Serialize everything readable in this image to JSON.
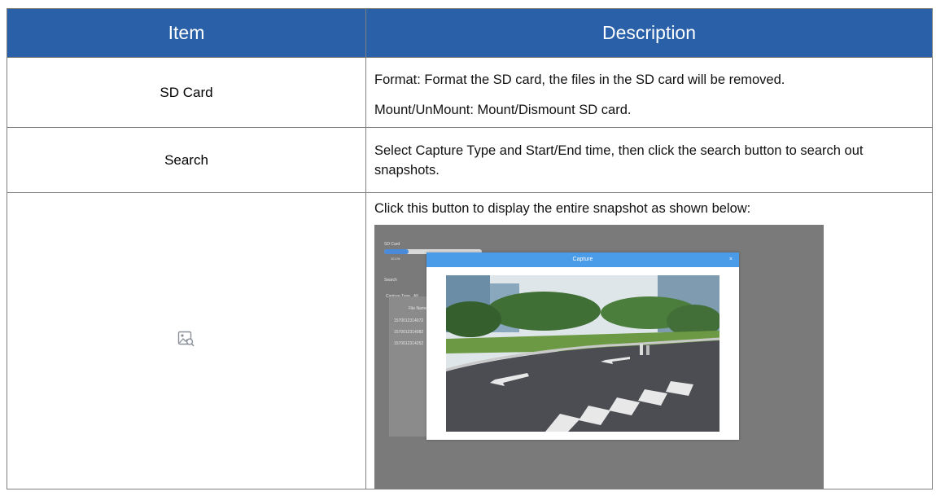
{
  "table": {
    "headers": [
      "Item",
      "Description"
    ],
    "rows": [
      {
        "item": "SD Card",
        "lines": [
          "Format: Format the SD card, the files in the SD card will be removed.",
          "Mount/UnMount: Mount/Dismount SD card."
        ]
      },
      {
        "item": "Search",
        "lines": [
          "Select Capture Type and Start/End time, then click the search button to search out snapshots."
        ]
      },
      {
        "item_icon": "image-search-icon",
        "lines": [
          "Click this button to display the entire snapshot as shown below:"
        ]
      }
    ]
  },
  "screenshot": {
    "sd_card_label": "SD Card",
    "progress_text": "10.1%",
    "search_label": "Search",
    "capture_type_label": "Capture Type",
    "capture_type_value": "All",
    "file_name_header": "File Name",
    "files": [
      "1570012314072",
      "1570012314082",
      "1570012314252"
    ],
    "modal_title": "Capture",
    "close_symbol": "×"
  },
  "colors": {
    "header_bg": "#2960a8",
    "header_text": "#ffffff",
    "border": "#7f7f7f",
    "modal_header": "#4a9be8"
  }
}
